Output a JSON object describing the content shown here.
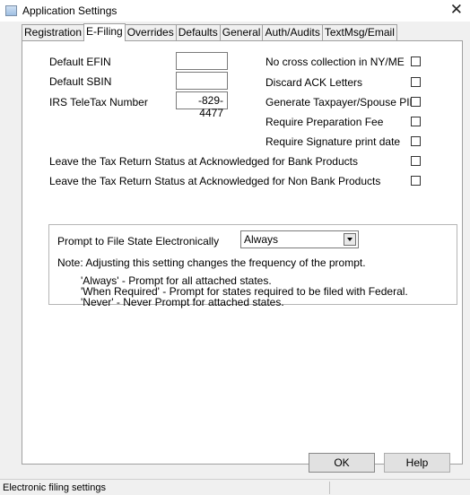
{
  "window": {
    "title": "Application Settings",
    "close_glyph": "✕"
  },
  "tabs": [
    {
      "label": "Registration"
    },
    {
      "label": "E-Filing"
    },
    {
      "label": "Overrides"
    },
    {
      "label": "Defaults"
    },
    {
      "label": "General"
    },
    {
      "label": "Auth/Audits"
    },
    {
      "label": "TextMsg/Email"
    }
  ],
  "active_tab": "E-Filing",
  "efiling": {
    "default_efin": {
      "label": "Default EFIN",
      "value": ""
    },
    "default_sbin": {
      "label": "Default SBIN",
      "value": ""
    },
    "irs_teletax": {
      "label": "IRS TeleTax Number",
      "value": "-829-4477"
    },
    "options": [
      {
        "label": "No cross collection in NY/ME",
        "checked": false
      },
      {
        "label": "Discard ACK Letters",
        "checked": false
      },
      {
        "label": "Generate Taxpayer/Spouse PIN",
        "checked": false
      },
      {
        "label": "Require Preparation Fee",
        "checked": false
      },
      {
        "label": "Require Signature print date",
        "checked": false
      }
    ],
    "status_options": [
      {
        "label": "Leave the Tax Return Status at Acknowledged for Bank Products",
        "checked": false
      },
      {
        "label": "Leave the Tax Return Status at Acknowledged for Non Bank Products",
        "checked": false
      }
    ],
    "prompt": {
      "label": "Prompt to File State Electronically",
      "selected": "Always",
      "note": "Note: Adjusting this setting changes the frequency of the prompt.",
      "explanations": [
        "'Always' - Prompt for all attached states.",
        "'When Required' - Prompt for states required to be filed with Federal.",
        "'Never' - Never Prompt for attached states."
      ]
    }
  },
  "buttons": {
    "ok": "OK",
    "help": "Help"
  },
  "statusbar": {
    "text": "Electronic filing settings"
  },
  "colors": {
    "window_bg": "#f0f0f0",
    "panel_bg": "#ffffff",
    "border": "#a0a0a0"
  }
}
